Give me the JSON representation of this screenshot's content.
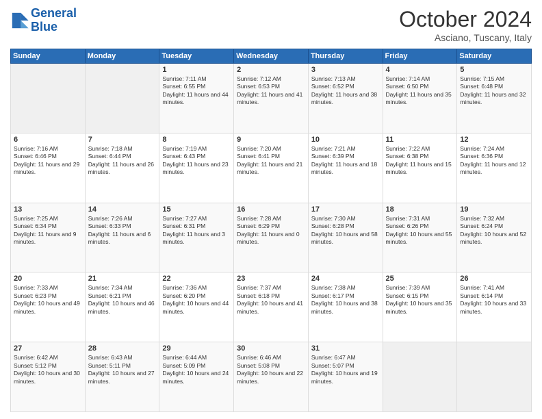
{
  "header": {
    "logo_line1": "General",
    "logo_line2": "Blue",
    "month": "October 2024",
    "location": "Asciano, Tuscany, Italy"
  },
  "days_of_week": [
    "Sunday",
    "Monday",
    "Tuesday",
    "Wednesday",
    "Thursday",
    "Friday",
    "Saturday"
  ],
  "weeks": [
    [
      {
        "day": "",
        "empty": true
      },
      {
        "day": "",
        "empty": true
      },
      {
        "day": "1",
        "sunrise": "7:11 AM",
        "sunset": "6:55 PM",
        "daylight": "11 hours and 44 minutes."
      },
      {
        "day": "2",
        "sunrise": "7:12 AM",
        "sunset": "6:53 PM",
        "daylight": "11 hours and 41 minutes."
      },
      {
        "day": "3",
        "sunrise": "7:13 AM",
        "sunset": "6:52 PM",
        "daylight": "11 hours and 38 minutes."
      },
      {
        "day": "4",
        "sunrise": "7:14 AM",
        "sunset": "6:50 PM",
        "daylight": "11 hours and 35 minutes."
      },
      {
        "day": "5",
        "sunrise": "7:15 AM",
        "sunset": "6:48 PM",
        "daylight": "11 hours and 32 minutes."
      }
    ],
    [
      {
        "day": "6",
        "sunrise": "7:16 AM",
        "sunset": "6:46 PM",
        "daylight": "11 hours and 29 minutes."
      },
      {
        "day": "7",
        "sunrise": "7:18 AM",
        "sunset": "6:44 PM",
        "daylight": "11 hours and 26 minutes."
      },
      {
        "day": "8",
        "sunrise": "7:19 AM",
        "sunset": "6:43 PM",
        "daylight": "11 hours and 23 minutes."
      },
      {
        "day": "9",
        "sunrise": "7:20 AM",
        "sunset": "6:41 PM",
        "daylight": "11 hours and 21 minutes."
      },
      {
        "day": "10",
        "sunrise": "7:21 AM",
        "sunset": "6:39 PM",
        "daylight": "11 hours and 18 minutes."
      },
      {
        "day": "11",
        "sunrise": "7:22 AM",
        "sunset": "6:38 PM",
        "daylight": "11 hours and 15 minutes."
      },
      {
        "day": "12",
        "sunrise": "7:24 AM",
        "sunset": "6:36 PM",
        "daylight": "11 hours and 12 minutes."
      }
    ],
    [
      {
        "day": "13",
        "sunrise": "7:25 AM",
        "sunset": "6:34 PM",
        "daylight": "11 hours and 9 minutes."
      },
      {
        "day": "14",
        "sunrise": "7:26 AM",
        "sunset": "6:33 PM",
        "daylight": "11 hours and 6 minutes."
      },
      {
        "day": "15",
        "sunrise": "7:27 AM",
        "sunset": "6:31 PM",
        "daylight": "11 hours and 3 minutes."
      },
      {
        "day": "16",
        "sunrise": "7:28 AM",
        "sunset": "6:29 PM",
        "daylight": "11 hours and 0 minutes."
      },
      {
        "day": "17",
        "sunrise": "7:30 AM",
        "sunset": "6:28 PM",
        "daylight": "10 hours and 58 minutes."
      },
      {
        "day": "18",
        "sunrise": "7:31 AM",
        "sunset": "6:26 PM",
        "daylight": "10 hours and 55 minutes."
      },
      {
        "day": "19",
        "sunrise": "7:32 AM",
        "sunset": "6:24 PM",
        "daylight": "10 hours and 52 minutes."
      }
    ],
    [
      {
        "day": "20",
        "sunrise": "7:33 AM",
        "sunset": "6:23 PM",
        "daylight": "10 hours and 49 minutes."
      },
      {
        "day": "21",
        "sunrise": "7:34 AM",
        "sunset": "6:21 PM",
        "daylight": "10 hours and 46 minutes."
      },
      {
        "day": "22",
        "sunrise": "7:36 AM",
        "sunset": "6:20 PM",
        "daylight": "10 hours and 44 minutes."
      },
      {
        "day": "23",
        "sunrise": "7:37 AM",
        "sunset": "6:18 PM",
        "daylight": "10 hours and 41 minutes."
      },
      {
        "day": "24",
        "sunrise": "7:38 AM",
        "sunset": "6:17 PM",
        "daylight": "10 hours and 38 minutes."
      },
      {
        "day": "25",
        "sunrise": "7:39 AM",
        "sunset": "6:15 PM",
        "daylight": "10 hours and 35 minutes."
      },
      {
        "day": "26",
        "sunrise": "7:41 AM",
        "sunset": "6:14 PM",
        "daylight": "10 hours and 33 minutes."
      }
    ],
    [
      {
        "day": "27",
        "sunrise": "6:42 AM",
        "sunset": "5:12 PM",
        "daylight": "10 hours and 30 minutes."
      },
      {
        "day": "28",
        "sunrise": "6:43 AM",
        "sunset": "5:11 PM",
        "daylight": "10 hours and 27 minutes."
      },
      {
        "day": "29",
        "sunrise": "6:44 AM",
        "sunset": "5:09 PM",
        "daylight": "10 hours and 24 minutes."
      },
      {
        "day": "30",
        "sunrise": "6:46 AM",
        "sunset": "5:08 PM",
        "daylight": "10 hours and 22 minutes."
      },
      {
        "day": "31",
        "sunrise": "6:47 AM",
        "sunset": "5:07 PM",
        "daylight": "10 hours and 19 minutes."
      },
      {
        "day": "",
        "empty": true
      },
      {
        "day": "",
        "empty": true
      }
    ]
  ]
}
